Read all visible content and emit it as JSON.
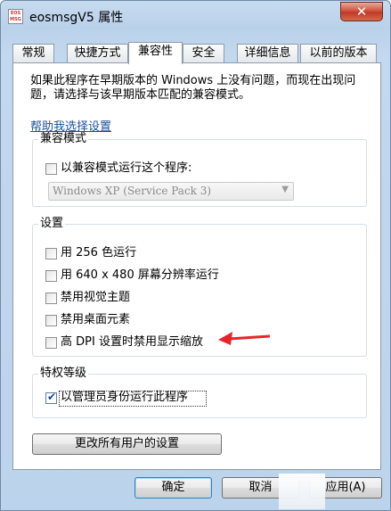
{
  "window": {
    "title": "eosmsgV5 属性",
    "icon": "app-icon",
    "icon_text": "EOS MSG",
    "close_label": "✕"
  },
  "tabs": [
    {
      "label": "常规",
      "active": false
    },
    {
      "label": "快捷方式",
      "active": false
    },
    {
      "label": "兼容性",
      "active": true
    },
    {
      "label": "安全",
      "active": false
    },
    {
      "label": "详细信息",
      "active": false
    },
    {
      "label": "以前的版本",
      "active": false
    }
  ],
  "intro": {
    "text": "如果此程序在早期版本的 Windows 上没有问题，而现在出现问题，请选择与该早期版本匹配的兼容模式。",
    "help_link": "帮助我选择设置"
  },
  "compat_mode": {
    "group_label": "兼容模式",
    "checkbox_label": "以兼容模式运行这个程序:",
    "checked": false,
    "select_value": "Windows XP (Service Pack 3)"
  },
  "settings": {
    "group_label": "设置",
    "items": [
      {
        "label": "用 256 色运行",
        "checked": false
      },
      {
        "label": "用 640 x 480 屏幕分辨率运行",
        "checked": false
      },
      {
        "label": "禁用视觉主题",
        "checked": false
      },
      {
        "label": "禁用桌面元素",
        "checked": false
      },
      {
        "label": "高 DPI 设置时禁用显示缩放",
        "checked": false
      }
    ]
  },
  "privilege": {
    "group_label": "特权等级",
    "checkbox_label": "以管理员身份运行此程序",
    "checked": true,
    "check_mark": "✔"
  },
  "change_all_button": "更改所有用户的设置",
  "footer": {
    "ok": "确定",
    "cancel": "取消",
    "apply": "应用(A)"
  },
  "colors": {
    "annotation_arrow": "#e8232b",
    "link": "#1a4f9c"
  }
}
